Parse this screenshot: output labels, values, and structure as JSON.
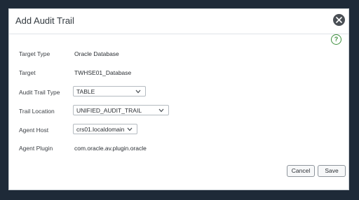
{
  "dialog": {
    "title": "Add Audit Trail",
    "help_label": "?"
  },
  "fields": {
    "target_type": {
      "label": "Target Type",
      "value": "Oracle Database"
    },
    "target": {
      "label": "Target",
      "value": "TWHSE01_Database"
    },
    "audit_trail_type": {
      "label": "Audit Trail Type",
      "value": "TABLE"
    },
    "trail_location": {
      "label": "Trail Location",
      "value": "UNIFIED_AUDIT_TRAIL"
    },
    "agent_host": {
      "label": "Agent Host",
      "value": "crs01.localdomain"
    },
    "agent_plugin": {
      "label": "Agent Plugin",
      "value": "com.oracle.av.plugin.oracle"
    }
  },
  "buttons": {
    "cancel": "Cancel",
    "save": "Save"
  },
  "icons": {
    "close": "close-icon",
    "help": "help-icon",
    "dropdown": "chevron-down-icon"
  },
  "colors": {
    "backdrop": "#1e2a38",
    "help_accent": "#3d8f3d"
  }
}
